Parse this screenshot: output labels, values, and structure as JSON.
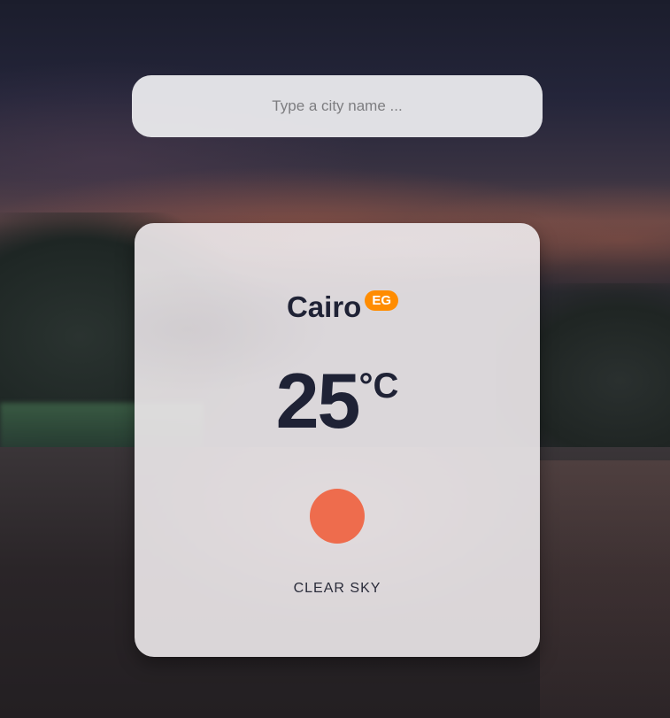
{
  "search": {
    "placeholder": "Type a city name ...",
    "value": ""
  },
  "weather": {
    "city": "Cairo",
    "country_code": "EG",
    "temperature": "25",
    "unit": "°C",
    "icon": "sun-icon",
    "description": "CLEAR SKY"
  },
  "colors": {
    "badge": "#ff8c00",
    "text": "#1f2235",
    "sun": "#ee6c4d"
  }
}
